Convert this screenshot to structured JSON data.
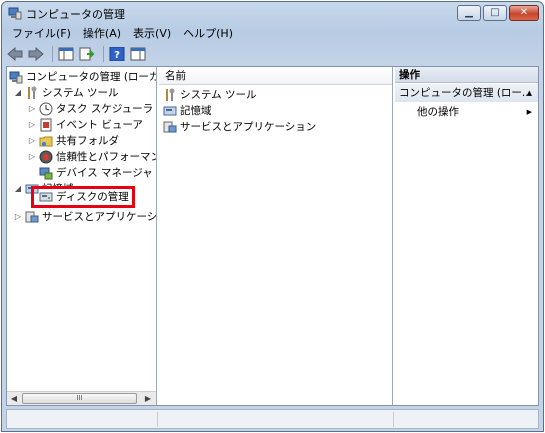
{
  "window": {
    "title": "コンピュータの管理"
  },
  "menu": [
    {
      "label": "ファイル(F)"
    },
    {
      "label": "操作(A)"
    },
    {
      "label": "表示(V)"
    },
    {
      "label": "ヘルプ(H)"
    }
  ],
  "tree": {
    "root": "コンピュータの管理 (ローカル",
    "system_tools": "システム ツール",
    "task_scheduler": "タスク スケジューラ",
    "event_viewer": "イベント ビューア",
    "shared_folders": "共有フォルダ",
    "reliability": "信頼性とパフォーマンス",
    "device_manager": "デバイス マネージャ",
    "storage": "記憶域",
    "disk_management": "ディスクの管理",
    "services_apps": "サービスとアプリケーション"
  },
  "list": {
    "header": "名前",
    "items": [
      {
        "label": "システム ツール"
      },
      {
        "label": "記憶域"
      },
      {
        "label": "サービスとアプリケーション"
      }
    ]
  },
  "actions": {
    "header": "操作",
    "section": "コンピュータの管理 (ロー...",
    "more": "他の操作"
  },
  "scrollbar": {
    "thumb_label": "III"
  },
  "colors": {
    "highlight": "#e60012"
  }
}
